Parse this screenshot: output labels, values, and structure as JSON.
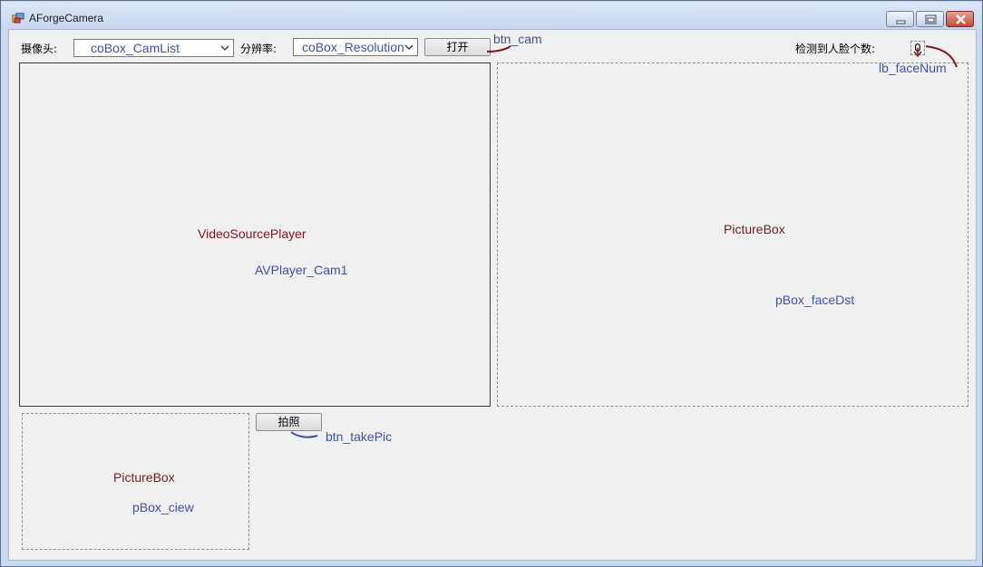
{
  "window": {
    "title": "AForgeCamera",
    "icon": "app-window-icon",
    "controls": {
      "minimize": "minimize-icon",
      "maximize": "maximize-icon",
      "close": "close-icon"
    }
  },
  "toolbar": {
    "camera_label": "摄像头:",
    "camera_combo_value": "coBox_CamList",
    "resolution_label": "分辨率:",
    "resolution_combo_value": "coBox_Resolution",
    "open_button": "打开",
    "open_button_name": "btn_cam",
    "face_count_label": "检测到人脸个数:",
    "face_count_value": "0",
    "face_count_name": "lb_faceNum"
  },
  "video_panel": {
    "type_label": "VideoSourcePlayer",
    "name_label": "AVPlayer_Cam1"
  },
  "face_panel": {
    "type_label": "PictureBox",
    "name_label": "pBox_faceDst"
  },
  "capture": {
    "button": "拍照",
    "button_name": "btn_takePic"
  },
  "preview_panel": {
    "type_label": "PictureBox",
    "name_label": "pBox_ciew"
  },
  "colors": {
    "control_type_text": "#7b1a1a",
    "control_name_text": "#3f50a7",
    "annotation_stroke_dark": "#7b1a1a",
    "annotation_stroke_blue": "#3f50a7"
  }
}
